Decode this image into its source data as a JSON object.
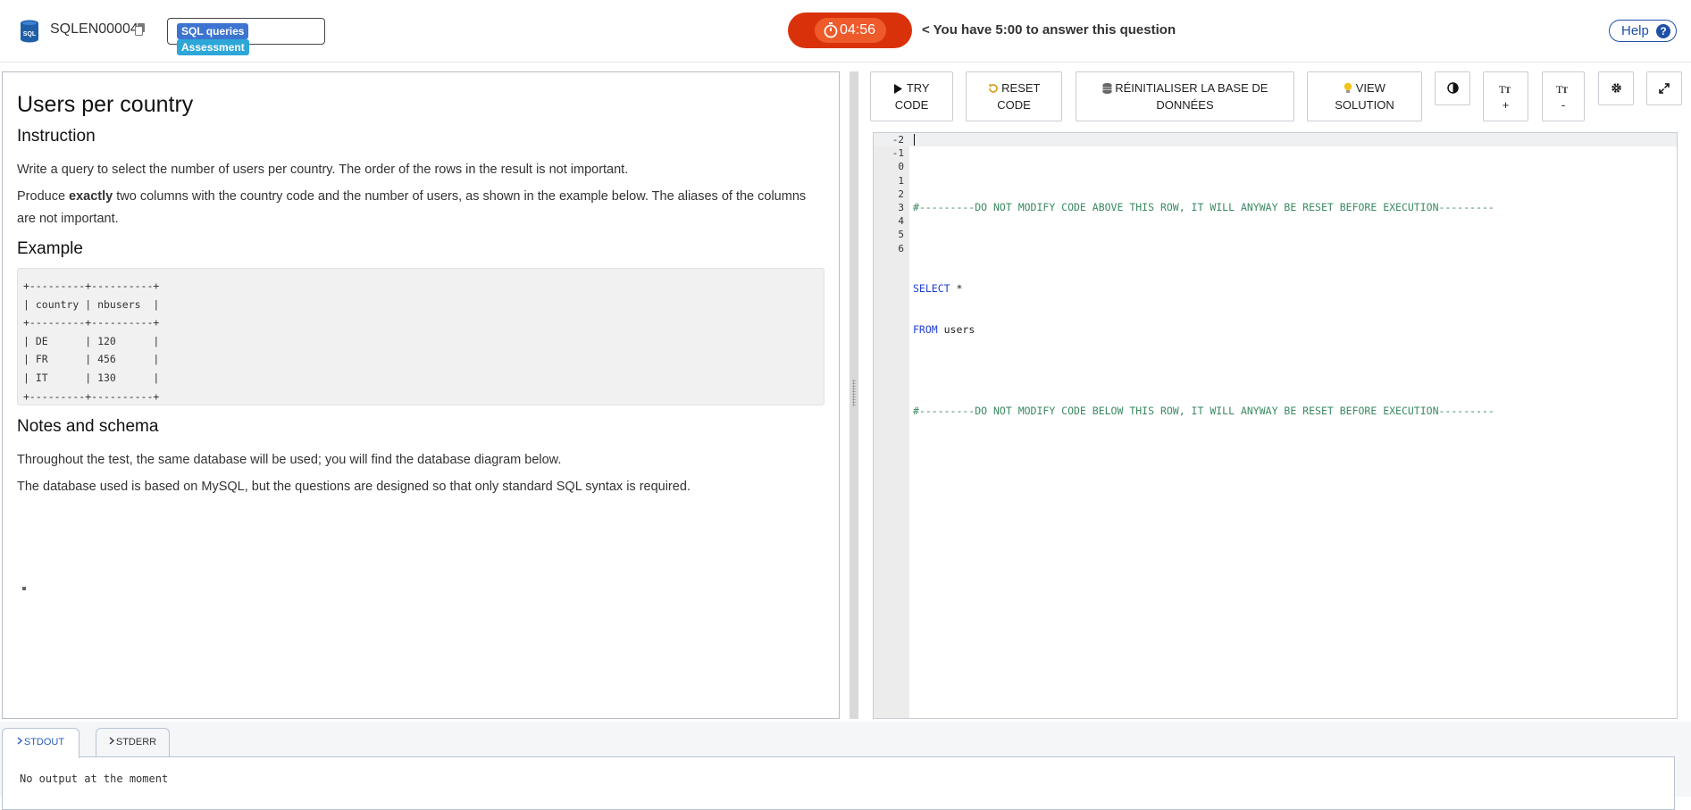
{
  "header": {
    "question_id": "SQLEN00004",
    "tags": [
      "SQL queries",
      "Assessment"
    ],
    "timer": "04:56",
    "timer_message": "< You have 5:00 to answer this question",
    "help_label": "Help"
  },
  "problem": {
    "title": "Users per country",
    "instruction_heading": "Instruction",
    "instruction_text_1": "Write a query to select the number of users per country. The order of the rows in the result is not important.",
    "instruction_text_2_pre": "Produce ",
    "instruction_text_2_bold": "exactly",
    "instruction_text_2_post": " two columns with the country code and the number of users, as shown in the example below. The aliases of the columns are not important.",
    "example_heading": "Example",
    "example_table": "+---------+----------+\n| country | nbusers  |\n+---------+----------+\n| DE      | 120      |\n| FR      | 456      |\n| IT      | 130      |\n+---------+----------+",
    "notes_heading": "Notes and schema",
    "notes_text_1": "Throughout the test, the same database will be used; you will find the database diagram below.",
    "notes_text_2": "The database used is based on MySQL, but the questions are designed so that only standard SQL syntax is required."
  },
  "toolbar": {
    "try_code_line1": "TRY",
    "try_code_line2": "CODE",
    "reset_code_line1": "RESET",
    "reset_code_line2": "CODE",
    "reset_db_line1": "RÉINITIALISER LA BASE DE",
    "reset_db_line2": "DONNÉES",
    "view_solution_line1": "VIEW",
    "view_solution_line2": "SOLUTION",
    "font_increase_label": "+",
    "font_decrease_label": "-"
  },
  "editor": {
    "line_numbers": [
      "-2",
      "-1",
      "0",
      "1",
      "2",
      "3",
      "4",
      "5",
      "6"
    ],
    "comment_above": "#---------DO NOT MODIFY CODE ABOVE THIS ROW, IT WILL ANYWAY BE RESET BEFORE EXECUTION---------",
    "select_kw": "SELECT",
    "select_rest": " *",
    "from_kw": "FROM",
    "from_rest": " users",
    "comment_below": "#---------DO NOT MODIFY CODE BELOW THIS ROW, IT WILL ANYWAY BE RESET BEFORE EXECUTION---------"
  },
  "output": {
    "tab_stdout": "STDOUT",
    "tab_stderr": "STDERR",
    "message": "No output at the moment"
  },
  "colors": {
    "timer_bg": "#d9320a",
    "timer_inner": "#ee5a2a",
    "tag_blue": "#3e74d1",
    "tag_cyan": "#2da6d8",
    "help_blue": "#1f4fa8",
    "comment_green": "#3b8a62",
    "keyword_blue": "#1f3fd6"
  },
  "icons": [
    "database-icon",
    "copy-icon",
    "stopwatch-icon",
    "help-icon",
    "play-icon",
    "undo-icon",
    "database-small-icon",
    "lightbulb-icon",
    "contrast-icon",
    "font-size-icon",
    "gear-icon",
    "expand-icon",
    "terminal-icon"
  ]
}
